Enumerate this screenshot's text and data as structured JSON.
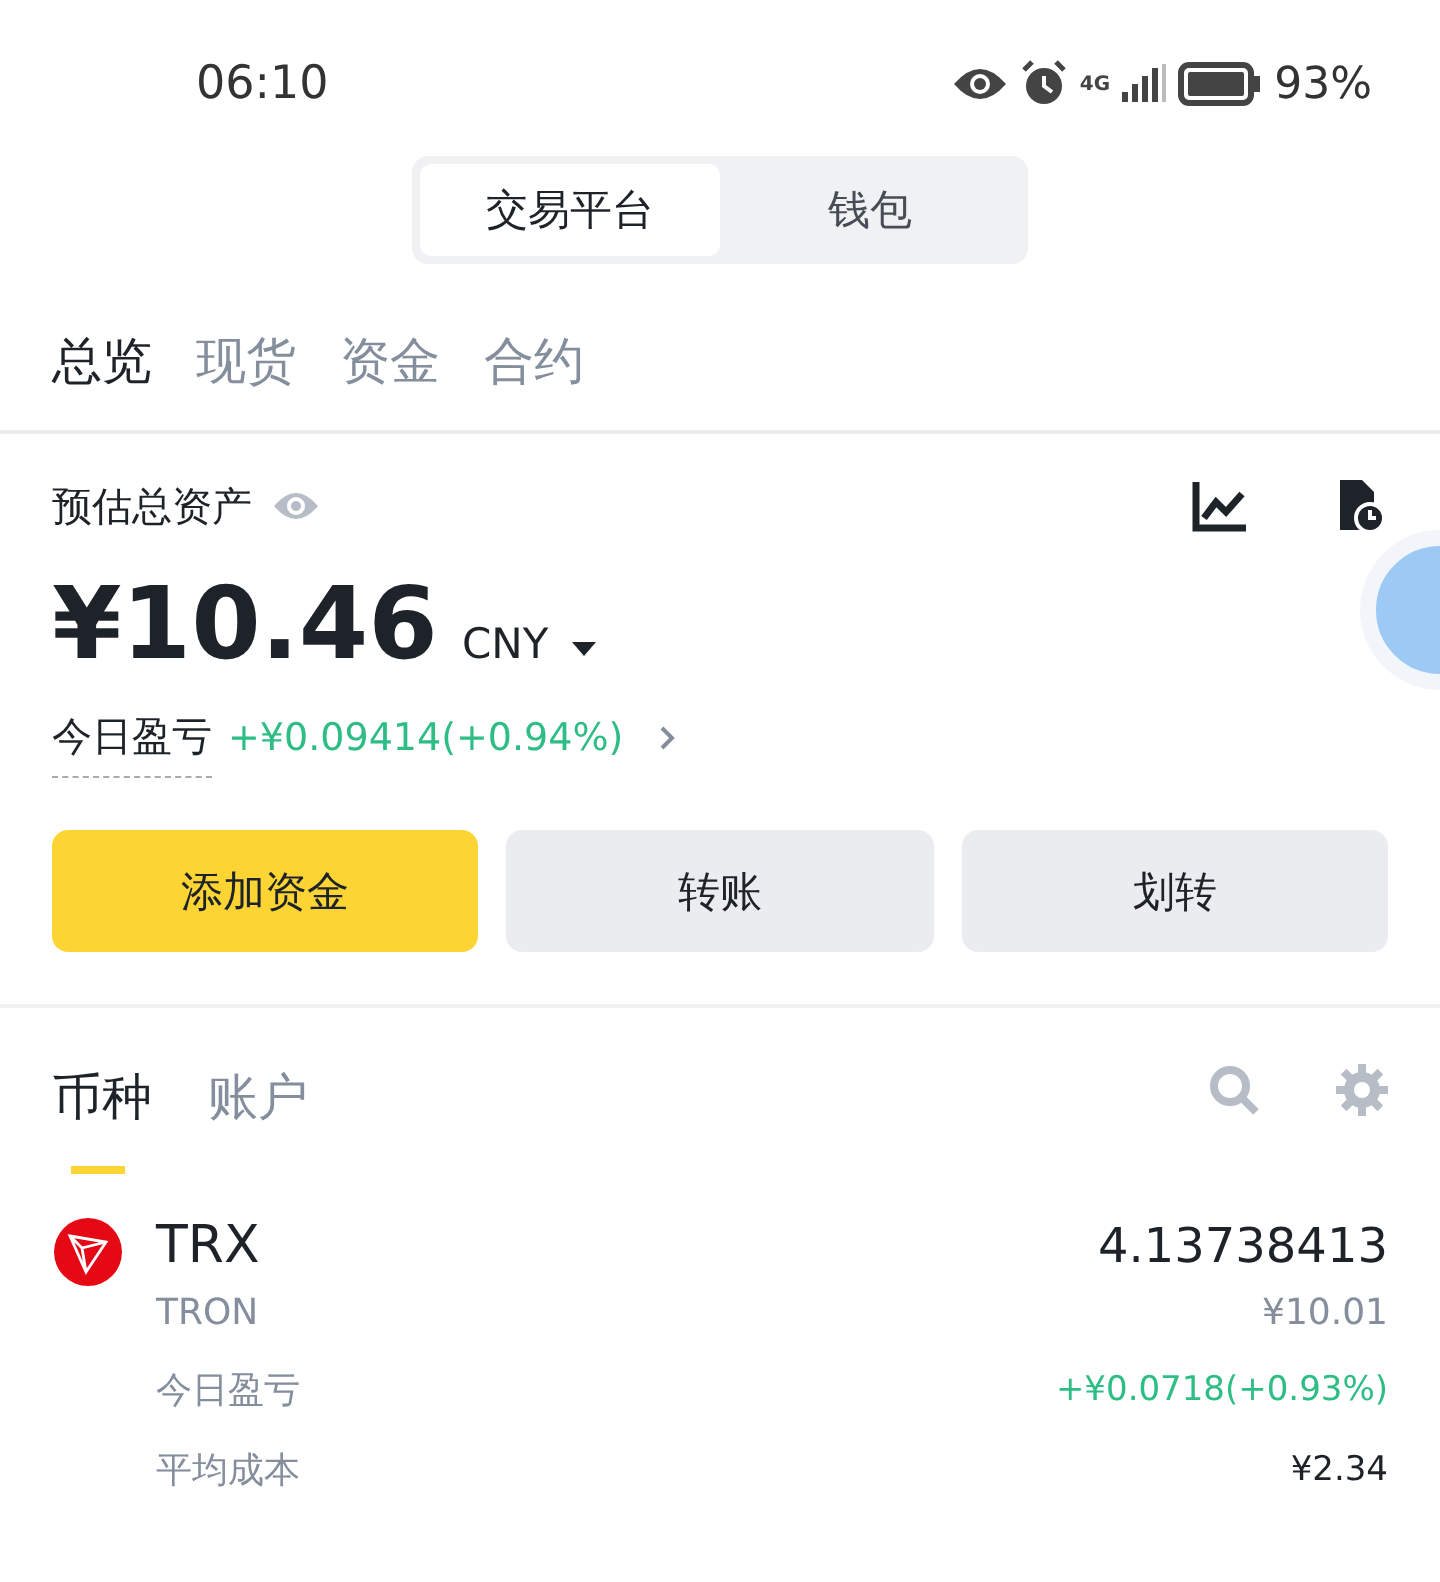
{
  "status_bar": {
    "time": "06:10",
    "network": "4G",
    "battery": "93%"
  },
  "segment": [
    {
      "label": "交易平台",
      "selected": true
    },
    {
      "label": "钱包",
      "selected": false
    }
  ],
  "tabs": [
    {
      "label": "总览",
      "selected": true
    },
    {
      "label": "现货",
      "selected": false
    },
    {
      "label": "资金",
      "selected": false
    },
    {
      "label": "合约",
      "selected": false
    }
  ],
  "overview": {
    "title": "预估总资产",
    "amount": "¥10.46",
    "currency": "CNY",
    "pnl_label": "今日盈亏",
    "pnl_value": "+¥0.09414(+0.94%)"
  },
  "buttons": [
    {
      "label": "添加资金",
      "kind": "primary"
    },
    {
      "label": "转账",
      "kind": "secondary"
    },
    {
      "label": "划转",
      "kind": "secondary"
    }
  ],
  "list_tabs": [
    {
      "label": "币种",
      "selected": true
    },
    {
      "label": "账户",
      "selected": false
    }
  ],
  "assets": [
    {
      "symbol": "TRX",
      "name": "TRON",
      "amount": "4.13738413",
      "value": "¥10.01",
      "pnl_label": "今日盈亏",
      "pnl_value": "+¥0.0718(+0.93%)",
      "cost_label": "平均成本",
      "cost_value": "¥2.34"
    }
  ]
}
